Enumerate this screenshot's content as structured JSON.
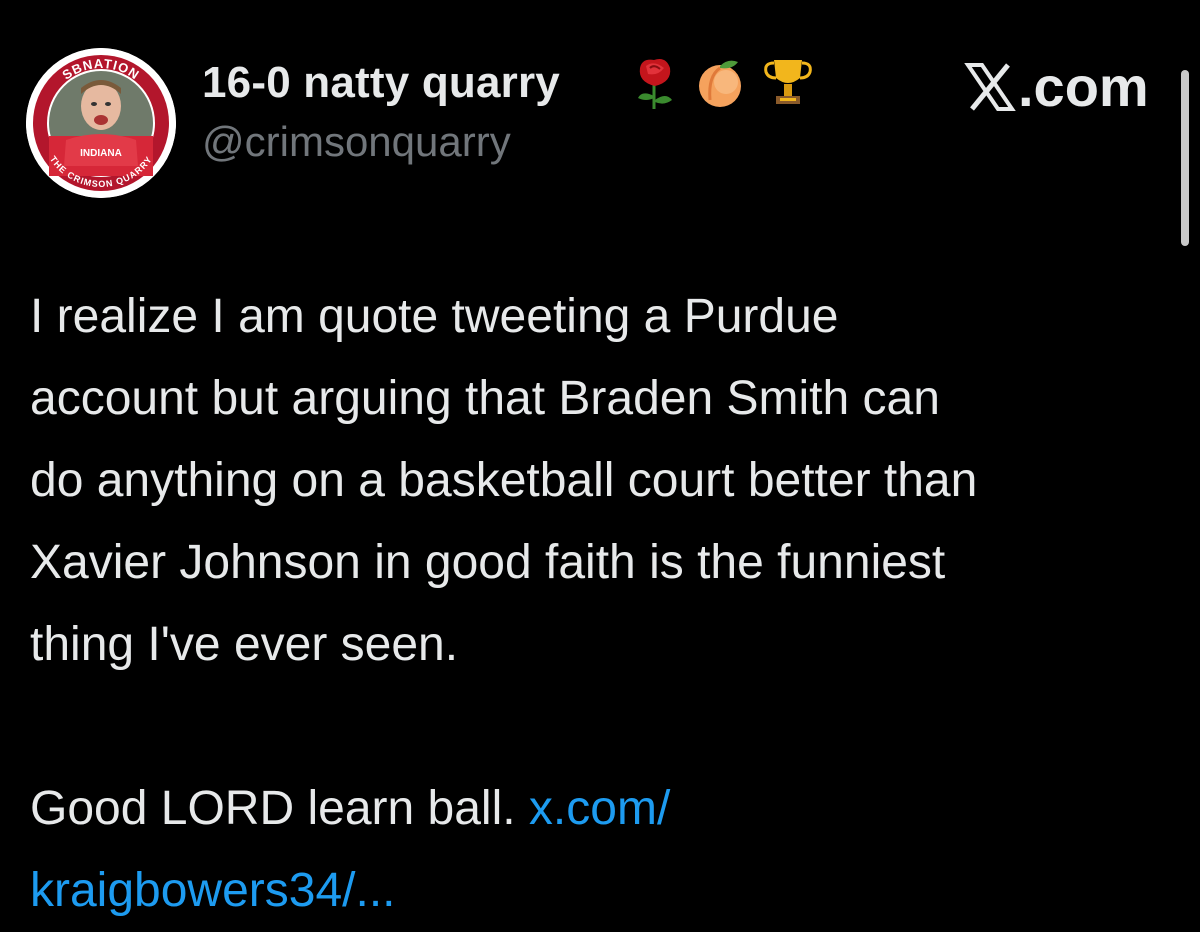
{
  "author": {
    "display_name": "16-0 natty quarry",
    "handle": "@crimsonquarry",
    "avatar": {
      "ring_text_top": "SBNATION",
      "ring_text_bottom": "THE CRIMSON QUARRY",
      "ring_color": "#b3162c"
    },
    "emojis": [
      "rose-emoji",
      "peach-emoji",
      "trophy-emoji"
    ]
  },
  "brand": {
    "label": ".com",
    "icon": "x-logo-icon"
  },
  "tweet": {
    "lines": [
      "I realize I am quote tweeting a Purdue",
      "account but arguing that Braden Smith can",
      "do anything on a basketball court better than",
      "Xavier Johnson in good faith is the funniest",
      "thing I've ever seen."
    ],
    "closing_text": "Good LORD learn ball.",
    "link_part1": "x.com/",
    "link_part2": "kraigbowers34/..."
  },
  "colors": {
    "background": "#000000",
    "text": "#e7e9ea",
    "secondary": "#71767b",
    "link": "#1d9bf0"
  }
}
